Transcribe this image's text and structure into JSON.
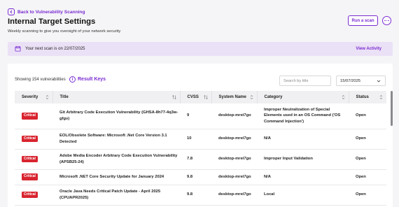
{
  "nav": {
    "back_label": "Back to Vulnerability Scanning"
  },
  "header": {
    "title": "Internal Target Settings",
    "subtitle": "Weekly scanning to give you oversight of your network security",
    "run_scan_label": "Run a scan",
    "more_icon": "more-horizontal-icon"
  },
  "banner": {
    "icon": "calendar-icon",
    "text": "Your next scan is on 22/07/2025",
    "action_label": "View Activity"
  },
  "toolbar": {
    "showing_text": "Showing 154 vulnerabilities",
    "result_keys_label": "Result Keys",
    "search_placeholder": "Search by title",
    "date_value": "15/07/2025"
  },
  "table": {
    "columns": [
      "Severity",
      "Title",
      "CVSS",
      "System Name",
      "Category",
      "Status"
    ],
    "rows": [
      {
        "severity": "Critical",
        "title": "Git Arbitrary Code Execution Vulnerability (GHSA-8h77-4q3w-gfgv)",
        "cvss": "9",
        "system": "desktop-mrei7go",
        "category": "Improper Neutralization of Special Elements used in an OS Command ('OS Command Injection')",
        "status": "Open"
      },
      {
        "severity": "Critical",
        "title": "EOL/Obsolete Software: Microsoft .Net Core Version 3.1 Detected",
        "cvss": "10",
        "system": "desktop-mrei7go",
        "category": "N/A",
        "status": "Open"
      },
      {
        "severity": "Critical",
        "title": "Adobe Media Encoder Arbitrary Code Execution Vulnerability (APSB25-24)",
        "cvss": "7.8",
        "system": "desktop-mrei7go",
        "category": "Improper Input Validation",
        "status": "Open"
      },
      {
        "severity": "Critical",
        "title": "Microsoft .NET Core Security Update for January 2024",
        "cvss": "9.8",
        "system": "desktop-mrei7go",
        "category": "N/A",
        "status": "Open"
      },
      {
        "severity": "Critical",
        "title": "Oracle Java Needs Critical Patch Update - April 2025 (CPUAPR2025)",
        "cvss": "9.8",
        "system": "desktop-mrei7go",
        "category": "Local",
        "status": "Open"
      }
    ]
  },
  "colors": {
    "accent": "#7a2bd1",
    "critical": "#d8242f",
    "banner_bg": "#ebe1f6"
  }
}
